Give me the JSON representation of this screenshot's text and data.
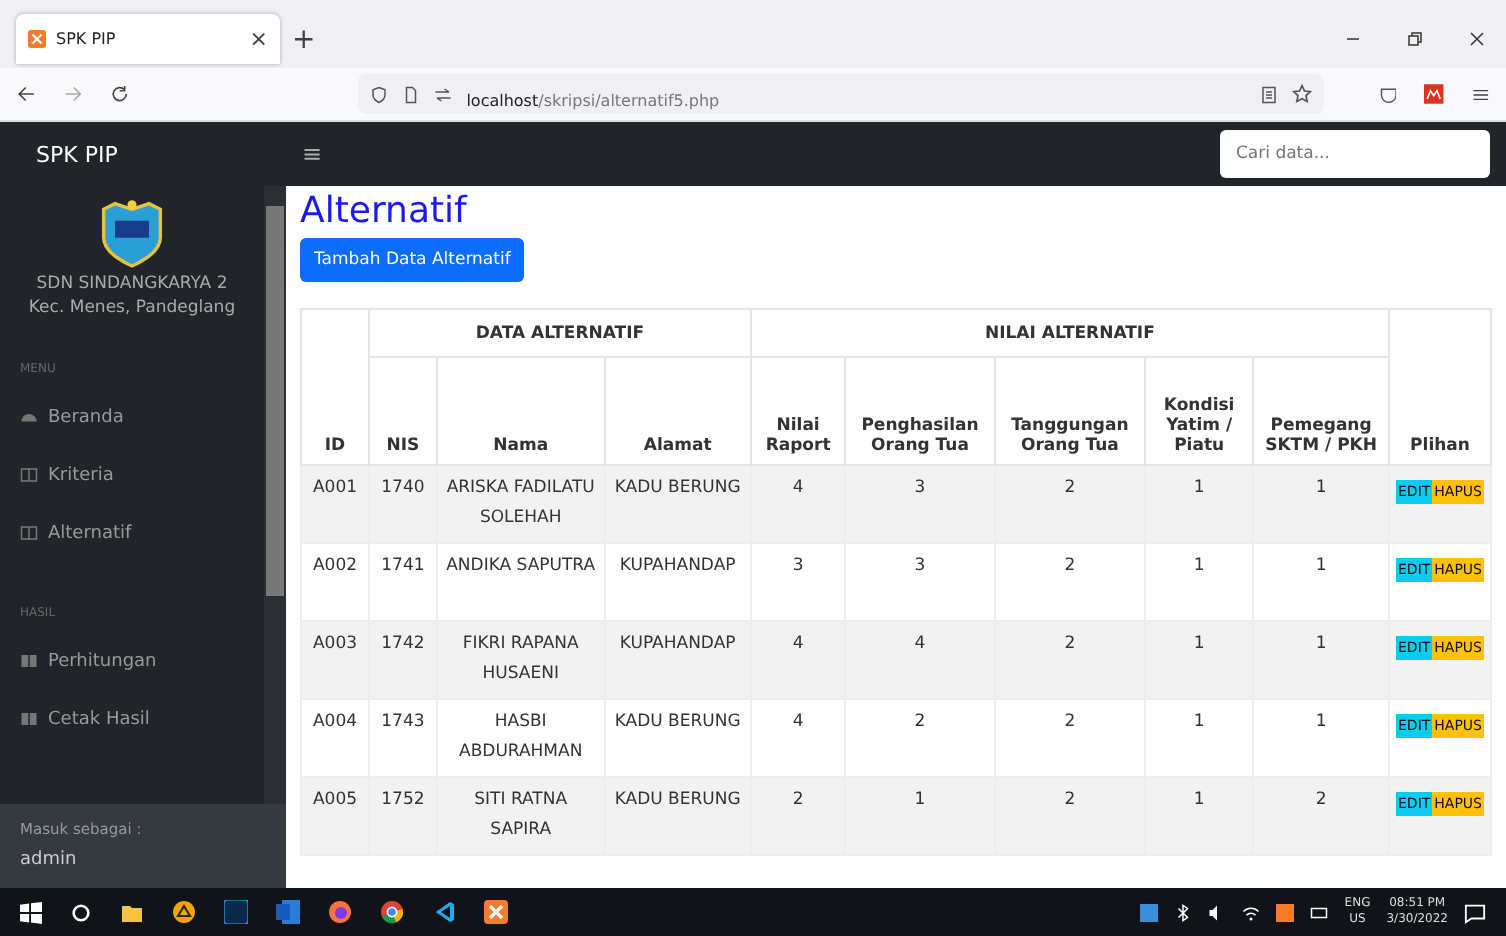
{
  "browser": {
    "tab": {
      "title": "SPK PIP",
      "close": "×"
    },
    "new_tab": "+",
    "url": {
      "host": "localhost",
      "path": "/skripsi/alternatif5.php"
    }
  },
  "navbar": {
    "brand": "SPK PIP",
    "menu_toggle": "≡",
    "search": {
      "placeholder": "Cari data..."
    }
  },
  "sidebar": {
    "school": "SDN SINDANGKARYA 2",
    "location": "Kec. Menes, Pandeglang",
    "sections": [
      {
        "heading": "MENU",
        "items": [
          {
            "label": "Beranda",
            "kind": "gauge"
          },
          {
            "label": "Kriteria",
            "kind": "columns"
          },
          {
            "label": "Alternatif",
            "kind": "columns"
          }
        ]
      },
      {
        "heading": "HASIL",
        "items": [
          {
            "label": "Perhitungan",
            "kind": "book"
          },
          {
            "label": "Cetak Hasil",
            "kind": "book"
          }
        ]
      }
    ],
    "footer": {
      "caption": "Masuk sebagai :",
      "user": "admin"
    }
  },
  "page": {
    "title": "Alternatif",
    "add_button": "Tambah Data Alternatif"
  },
  "table": {
    "id_column": "ID",
    "group_1": "DATA ALTERNATIF",
    "group_2": "NILAI ALTERNATIF",
    "action_column": "Plihan",
    "data_columns": [
      "NIS",
      "Nama",
      "Alamat"
    ],
    "value_columns": [
      "Nilai Raport",
      "Penghasilan Orang Tua",
      "Tanggungan Orang Tua",
      "Kondisi Yatim / Piatu",
      "Pemegang SKTM / PKH"
    ],
    "rows": [
      {
        "id": "A001",
        "cells": [
          "1740",
          "ARISKA FADILATU SOLEHAH",
          "KADU BERUNG"
        ],
        "values": [
          "4",
          "3",
          "2",
          "1",
          "1"
        ],
        "edit": "EDIT",
        "delete": "HAPUS"
      },
      {
        "id": "A002",
        "cells": [
          "1741",
          "ANDIKA SAPUTRA",
          "KUPAHANDAP"
        ],
        "values": [
          "3",
          "3",
          "2",
          "1",
          "1"
        ],
        "edit": "EDIT",
        "delete": "HAPUS"
      },
      {
        "id": "A003",
        "cells": [
          "1742",
          "FIKRI RAPANA HUSAENI",
          "KUPAHANDAP"
        ],
        "values": [
          "4",
          "4",
          "2",
          "1",
          "1"
        ],
        "edit": "EDIT",
        "delete": "HAPUS"
      },
      {
        "id": "A004",
        "cells": [
          "1743",
          "HASBI ABDURAHMAN",
          "KADU BERUNG"
        ],
        "values": [
          "4",
          "2",
          "2",
          "1",
          "1"
        ],
        "edit": "EDIT",
        "delete": "HAPUS"
      },
      {
        "id": "A005",
        "cells": [
          "1752",
          "SITI RATNA SAPIRA",
          "KADU BERUNG"
        ],
        "values": [
          "2",
          "1",
          "2",
          "1",
          "2"
        ],
        "edit": "EDIT",
        "delete": "HAPUS"
      }
    ]
  },
  "taskbar": {
    "language": "ENG",
    "region": "US",
    "time": "08:51 PM",
    "date": "3/30/2022"
  }
}
